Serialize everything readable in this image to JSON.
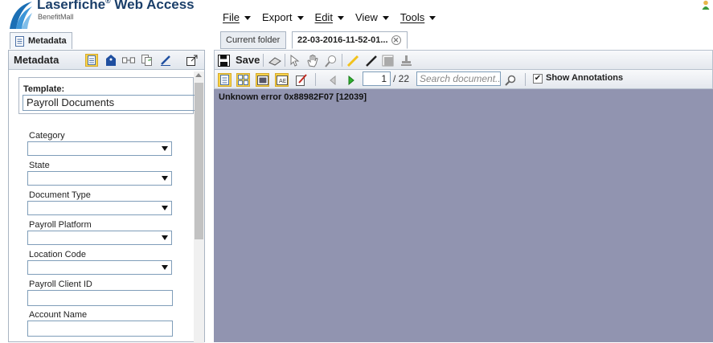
{
  "header": {
    "logo_title": "Laserfiche",
    "logo_product": "Web Access",
    "logo_subtitle": "BenefitMall"
  },
  "menubar": {
    "items": [
      {
        "label": "File"
      },
      {
        "label": "Export"
      },
      {
        "label": "Edit"
      },
      {
        "label": "View"
      },
      {
        "label": "Tools"
      }
    ]
  },
  "left_panel": {
    "tab_label": "Metadata",
    "title": "Metadata",
    "template_label": "Template:",
    "template_value": "Payroll Documents",
    "fields": [
      {
        "label": "Category",
        "type": "select",
        "value": ""
      },
      {
        "label": "State",
        "type": "select",
        "value": ""
      },
      {
        "label": "Document Type",
        "type": "select",
        "value": ""
      },
      {
        "label": "Payroll Platform",
        "type": "select",
        "value": ""
      },
      {
        "label": "Location Code",
        "type": "select",
        "value": ""
      },
      {
        "label": "Payroll Client ID",
        "type": "text",
        "value": ""
      },
      {
        "label": "Account Name",
        "type": "text",
        "value": ""
      }
    ]
  },
  "tabs": {
    "current_folder": "Current folder",
    "document": "22-03-2016-11-52-01..."
  },
  "toolbar": {
    "save_label": "Save",
    "page_number": "1",
    "page_total": "/ 22",
    "search_placeholder": "Search document...",
    "show_annotations_label": "Show Annotations",
    "show_annotations_checked": true
  },
  "viewer": {
    "error_text": "Unknown error 0x88982F07 [12039]"
  },
  "colors": {
    "viewer_bg": "#9194b0",
    "brand": "#1b3f6a",
    "accent_yellow": "#f6d24a"
  }
}
